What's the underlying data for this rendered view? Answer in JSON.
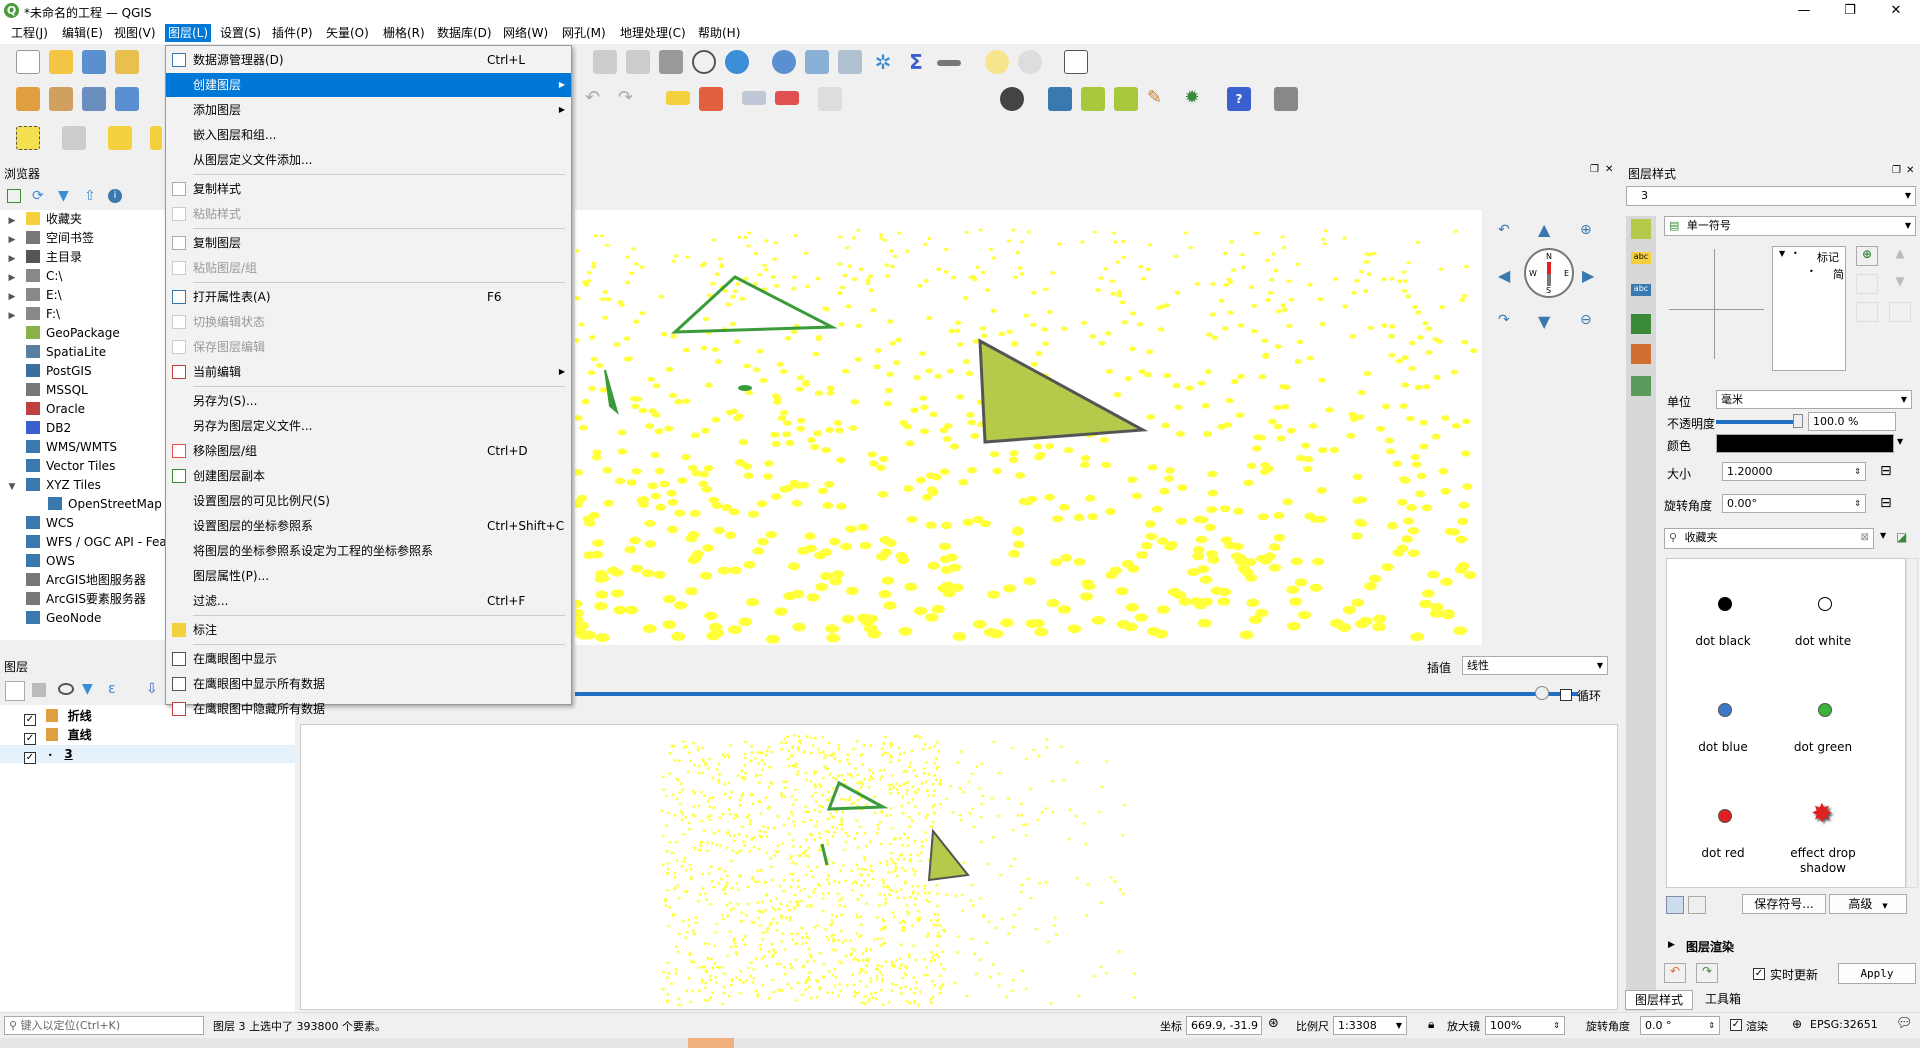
{
  "window": {
    "title": "*未命名的工程 — QGIS",
    "app_icon": "Q"
  },
  "menubar": [
    "工程(J)",
    "编辑(E)",
    "视图(V)",
    "图层(L)",
    "设置(S)",
    "插件(P)",
    "矢量(O)",
    "栅格(R)",
    "数据库(D)",
    "网络(W)",
    "网孔(M)",
    "地理处理(C)",
    "帮助(H)"
  ],
  "layer_menu": {
    "items": [
      {
        "label": "数据源管理器(D)",
        "shortcut": "Ctrl+L",
        "arrow": false,
        "disabled": false
      },
      {
        "label": "创建图层",
        "shortcut": "",
        "arrow": true,
        "disabled": false,
        "highlighted": true
      },
      {
        "label": "添加图层",
        "shortcut": "",
        "arrow": true,
        "disabled": false
      },
      {
        "label": "嵌入图层和组...",
        "shortcut": "",
        "arrow": false,
        "disabled": false
      },
      {
        "label": "从图层定义文件添加...",
        "shortcut": "",
        "arrow": false,
        "disabled": false
      },
      {
        "label": "复制样式",
        "shortcut": "",
        "arrow": false,
        "disabled": false
      },
      {
        "label": "粘贴样式",
        "shortcut": "",
        "arrow": false,
        "disabled": true
      },
      {
        "label": "复制图层",
        "shortcut": "",
        "arrow": false,
        "disabled": false
      },
      {
        "label": "粘贴图层/组",
        "shortcut": "",
        "arrow": false,
        "disabled": true
      },
      {
        "label": "打开属性表(A)",
        "shortcut": "F6",
        "arrow": false,
        "disabled": false
      },
      {
        "label": "切换编辑状态",
        "shortcut": "",
        "arrow": false,
        "disabled": true
      },
      {
        "label": "保存图层编辑",
        "shortcut": "",
        "arrow": false,
        "disabled": true
      },
      {
        "label": "当前编辑",
        "shortcut": "",
        "arrow": true,
        "disabled": false
      },
      {
        "label": "另存为(S)...",
        "shortcut": "",
        "arrow": false,
        "disabled": false
      },
      {
        "label": "另存为图层定义文件...",
        "shortcut": "",
        "arrow": false,
        "disabled": false
      },
      {
        "label": "移除图层/组",
        "shortcut": "Ctrl+D",
        "arrow": false,
        "disabled": false
      },
      {
        "label": "创建图层副本",
        "shortcut": "",
        "arrow": false,
        "disabled": false
      },
      {
        "label": "设置图层的可见比例尺(S)",
        "shortcut": "",
        "arrow": false,
        "disabled": false
      },
      {
        "label": "设置图层的坐标参照系",
        "shortcut": "Ctrl+Shift+C",
        "arrow": false,
        "disabled": false
      },
      {
        "label": "将图层的坐标参照系设定为工程的坐标参照系",
        "shortcut": "",
        "arrow": false,
        "disabled": false
      },
      {
        "label": "图层属性(P)...",
        "shortcut": "",
        "arrow": false,
        "disabled": false
      },
      {
        "label": "过滤...",
        "shortcut": "Ctrl+F",
        "arrow": false,
        "disabled": false
      },
      {
        "label": "标注",
        "shortcut": "",
        "arrow": false,
        "disabled": false
      },
      {
        "label": "在鹰眼图中显示",
        "shortcut": "",
        "arrow": false,
        "disabled": false
      },
      {
        "label": "在鹰眼图中显示所有数据",
        "shortcut": "",
        "arrow": false,
        "disabled": false
      },
      {
        "label": "在鹰眼图中隐藏所有数据",
        "shortcut": "",
        "arrow": false,
        "disabled": false
      }
    ]
  },
  "browser": {
    "title": "浏览器",
    "items": [
      {
        "label": "收藏夹",
        "arrow": true
      },
      {
        "label": "空间书签",
        "arrow": true
      },
      {
        "label": "主目录",
        "arrow": true
      },
      {
        "label": "C:\\",
        "arrow": true
      },
      {
        "label": "E:\\",
        "arrow": true
      },
      {
        "label": "F:\\",
        "arrow": true
      },
      {
        "label": "GeoPackage",
        "arrow": false
      },
      {
        "label": "SpatiaLite",
        "arrow": false
      },
      {
        "label": "PostGIS",
        "arrow": false
      },
      {
        "label": "MSSQL",
        "arrow": false
      },
      {
        "label": "Oracle",
        "arrow": false
      },
      {
        "label": "DB2",
        "arrow": false
      },
      {
        "label": "WMS/WMTS",
        "arrow": false
      },
      {
        "label": "Vector Tiles",
        "arrow": false
      },
      {
        "label": "XYZ Tiles",
        "arrow": true
      },
      {
        "label": "OpenStreetMap",
        "arrow": false
      },
      {
        "label": "WCS",
        "arrow": false
      },
      {
        "label": "WFS / OGC API - Fea",
        "arrow": false
      },
      {
        "label": "OWS",
        "arrow": false
      },
      {
        "label": "ArcGIS地图服务器",
        "arrow": false
      },
      {
        "label": "ArcGIS要素服务器",
        "arrow": false
      },
      {
        "label": "GeoNode",
        "arrow": false
      }
    ]
  },
  "layers_panel": {
    "title": "图层",
    "layers": [
      {
        "name": "折线",
        "checked": true
      },
      {
        "name": "直线",
        "checked": true
      },
      {
        "name": "3",
        "checked": true
      }
    ]
  },
  "map_controls": {
    "interpolation_label": "插值",
    "interpolation_value": "线性",
    "loop_label": "循环"
  },
  "style_panel": {
    "title": "图层样式",
    "layer_select": "3",
    "renderer": "单一符号",
    "tree_label": "标记",
    "tree_sublabel": "简",
    "unit_label": "单位",
    "unit_value": "毫米",
    "opacity_label": "不透明度",
    "opacity_value": "100.0 %",
    "color_label": "颜色",
    "size_label": "大小",
    "size_value": "1.20000",
    "rotation_label": "旋转角度",
    "rotation_value": "0.00°",
    "search_value": "收藏夹",
    "symbols": [
      {
        "name": "dot  black",
        "color": "#000000",
        "hollow": false
      },
      {
        "name": "dot  white",
        "color": "#ffffff",
        "hollow": true
      },
      {
        "name": "dot blue",
        "color": "#3c78c8",
        "hollow": false
      },
      {
        "name": "dot green",
        "color": "#3cb43c",
        "hollow": false
      },
      {
        "name": "dot red",
        "color": "#e02020",
        "hollow": false
      },
      {
        "name": "effect drop shadow",
        "color": "#e02020",
        "hollow": false
      }
    ],
    "save_symbol": "保存符号...",
    "advanced": "高级",
    "layer_rendering": "图层渲染",
    "live_update": "实时更新",
    "apply": "Apply",
    "tab_style": "图层样式",
    "tab_toolbox": "工具箱"
  },
  "statusbar": {
    "locate_placeholder": "键入以定位(Ctrl+K)",
    "message": "图层 3 上选中了 393800 个要素。",
    "coord_label": "坐标",
    "coord_value": "669.9, -31.9",
    "scale_label": "比例尺",
    "scale_value": "1:3308",
    "magnifier_label": "放大镜",
    "magnifier_value": "100%",
    "rotation_label": "旋转角度",
    "rotation_value": "0.0 °",
    "render_label": "渲染",
    "crs": "EPSG:32651"
  }
}
